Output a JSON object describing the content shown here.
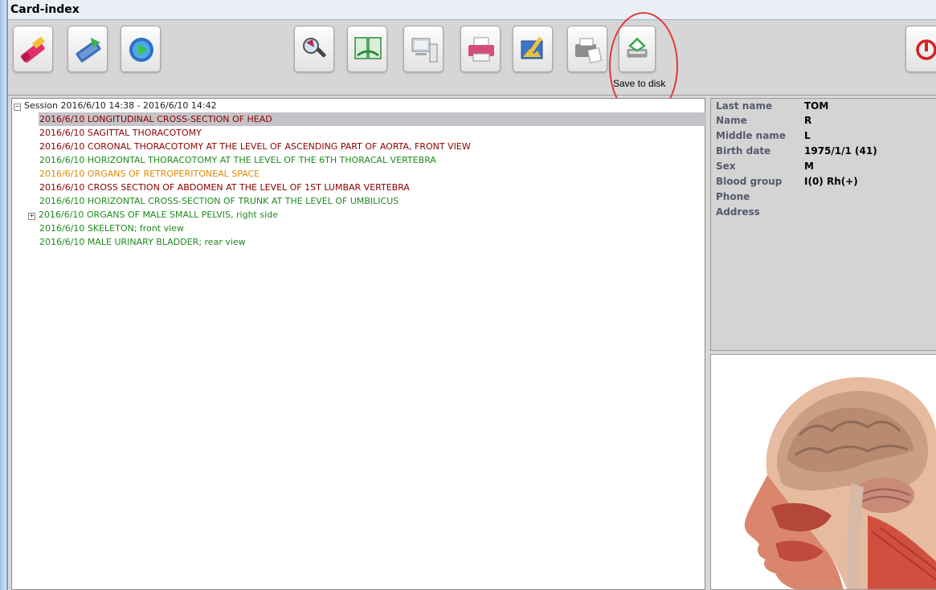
{
  "window": {
    "title": "Card-index"
  },
  "toolbar": {
    "buttons": [
      {
        "name": "edit-record-button",
        "icon": "pencil-eraser-icon"
      },
      {
        "name": "transfer-button",
        "icon": "transfer-arrows-icon"
      },
      {
        "name": "play-button",
        "icon": "play-circle-icon"
      },
      {
        "name": "search-button",
        "icon": "magnifier-icon"
      },
      {
        "name": "compare-button",
        "icon": "documents-icon"
      },
      {
        "name": "display-button",
        "icon": "computer-icon"
      },
      {
        "name": "print-button",
        "icon": "printer-icon"
      },
      {
        "name": "image-button",
        "icon": "picture-pencil-icon"
      },
      {
        "name": "fax-button",
        "icon": "fax-icon"
      },
      {
        "name": "save-to-disk-button",
        "icon": "disk-save-icon"
      },
      {
        "name": "exit-button",
        "icon": "power-icon"
      }
    ],
    "tooltip": "Save to disk"
  },
  "tree": {
    "session": "Session 2016/6/10 14:38 - 2016/6/10 14:42",
    "items": [
      {
        "text": "2016/6/10  LONGITUDINAL CROSS-SECTION OF HEAD",
        "color": "#8b0000",
        "selected": true
      },
      {
        "text": "2016/6/10  SAGITTAL THORACOTOMY",
        "color": "#8b0000"
      },
      {
        "text": "2016/6/10  CORONAL THORACOTOMY AT THE LEVEL OF ASCENDING PART OF AORTA, FRONT VIEW",
        "color": "#8b0000"
      },
      {
        "text": "2016/6/10  HORIZONTAL THORACOTOMY AT THE LEVEL OF THE 6TH THORACAL VERTEBRA",
        "color": "#1e8b1e"
      },
      {
        "text": "2016/6/10  ORGANS OF RETROPERITONEAL SPACE",
        "color": "#e08a00"
      },
      {
        "text": "2016/6/10  CROSS SECTION OF ABDOMEN AT THE LEVEL OF 1ST LUMBAR VERTEBRA",
        "color": "#8b0000"
      },
      {
        "text": "2016/6/10  HORIZONTAL CROSS-SECTION OF TRUNK AT THE LEVEL OF UMBILICUS",
        "color": "#1e8b1e"
      },
      {
        "text": "2016/6/10  ORGANS OF MALE SMALL PELVIS, right side",
        "color": "#1e8b1e"
      },
      {
        "text": "2016/6/10  SKELETON; front view",
        "color": "#1e8b1e"
      },
      {
        "text": "2016/6/10  MALE URINARY BLADDER; rear view",
        "color": "#1e8b1e"
      }
    ]
  },
  "patient": {
    "last_name_label": "Last name",
    "last_name": "TOM",
    "name_label": "Name",
    "name": "R",
    "middle_name_label": "Middle name",
    "middle_name": "L",
    "birth_date_label": "Birth date",
    "birth_date": "1975/1/1 (41)",
    "sex_label": "Sex",
    "sex": "M",
    "blood_group_label": "Blood group",
    "blood_group": "I(0)  Rh(+)",
    "phone_label": "Phone",
    "phone": "",
    "address_label": "Address",
    "address": ""
  }
}
